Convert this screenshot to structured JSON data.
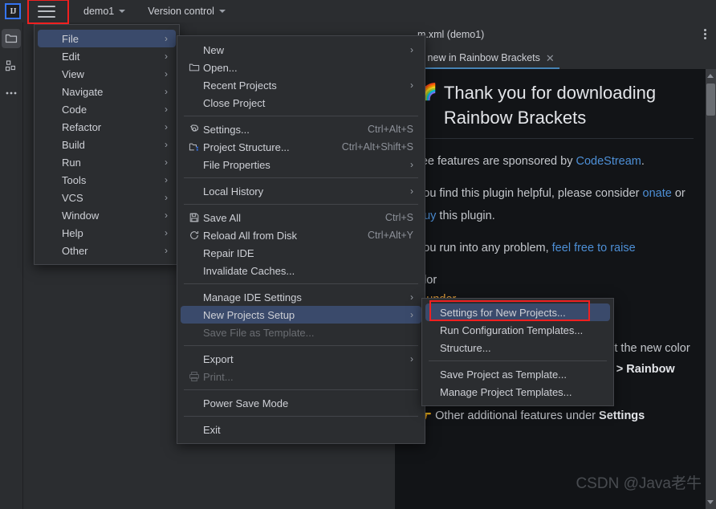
{
  "colors": {
    "bg": "#2b2d30",
    "editor_bg": "#1e1f22",
    "content_bg": "#121417",
    "accent_select": "#3a4a6b",
    "highlight_box": "#f02020",
    "link": "#4d8fd6",
    "tab_underline": "#4682b4",
    "text": "#ced0d6",
    "muted": "#8d9199"
  },
  "titlebar": {
    "logo_text": "IJ",
    "hamburger_icon": "hamburger-menu-icon",
    "project_name": "demo1",
    "version_control": "Version control"
  },
  "rail": {
    "items": [
      {
        "name": "project-tool-window",
        "icon": "folder-icon",
        "active": true
      },
      {
        "name": "structure-tool-window",
        "icon": "structure-icon",
        "active": false
      },
      {
        "name": "more-tool-windows",
        "icon": "ellipsis-icon",
        "active": false
      }
    ]
  },
  "editor": {
    "file_label": "m.xml (demo1)",
    "kebab_icon": "more-vertical-icon",
    "tab": {
      "label": "at's new in Rainbow Brackets",
      "close_icon": "close-icon"
    },
    "scrollbar": {
      "up_icon": "scroll-up-arrow-icon",
      "down_icon": "scroll-down-arrow-icon"
    }
  },
  "whats_new": {
    "rainbow_icon": "rainbow-emoji",
    "heading": "Thank you for downloading Rainbow Brackets",
    "p1_pre": "ree features are sponsored by ",
    "p1_link": "CodeStream",
    "p1_post": ".",
    "p2_pre": "you find this plugin helpful, please consider ",
    "p2_link1": "onate",
    "p2_mid": " or ",
    "p2_link2": "buy",
    "p2_post": " this plugin.",
    "p3_pre": "you run into any problem, ",
    "p3_link": "feel free to raise",
    "frag_color": "olor",
    "frag_under": "it under",
    "frag_gt": ">",
    "bullet1_icon": "pointing-finger-icon",
    "bullet1_pre": "Tired of the bundled colors? Try out the new color generator! ",
    "bullet1_bold": "Settings > Other Settings > Rainbow Brackets > Use color generator",
    "bullet2_icon": "pointing-finger-icon",
    "bullet2_pre": "Other additional features under ",
    "bullet2_bold": "Settings"
  },
  "menu_main": {
    "items": [
      {
        "label": "File",
        "selected": true,
        "submenu": true
      },
      {
        "label": "Edit",
        "selected": false,
        "submenu": true
      },
      {
        "label": "View",
        "selected": false,
        "submenu": true
      },
      {
        "label": "Navigate",
        "selected": false,
        "submenu": true
      },
      {
        "label": "Code",
        "selected": false,
        "submenu": true
      },
      {
        "label": "Refactor",
        "selected": false,
        "submenu": true
      },
      {
        "label": "Build",
        "selected": false,
        "submenu": true
      },
      {
        "label": "Run",
        "selected": false,
        "submenu": true
      },
      {
        "label": "Tools",
        "selected": false,
        "submenu": true
      },
      {
        "label": "VCS",
        "selected": false,
        "submenu": true
      },
      {
        "label": "Window",
        "selected": false,
        "submenu": true
      },
      {
        "label": "Help",
        "selected": false,
        "submenu": true
      },
      {
        "label": "Other",
        "selected": false,
        "submenu": true
      }
    ]
  },
  "menu_file": {
    "groups": [
      {
        "items": [
          {
            "label": "New",
            "icon": "",
            "accel": "",
            "submenu": true,
            "disabled": false,
            "selected": false
          },
          {
            "label": "Open...",
            "icon": "folder-icon",
            "accel": "",
            "submenu": false,
            "disabled": false,
            "selected": false
          },
          {
            "label": "Recent Projects",
            "icon": "",
            "accel": "",
            "submenu": true,
            "disabled": false,
            "selected": false
          },
          {
            "label": "Close Project",
            "icon": "",
            "accel": "",
            "submenu": false,
            "disabled": false,
            "selected": false
          }
        ]
      },
      {
        "items": [
          {
            "label": "Settings...",
            "icon": "gear-icon",
            "accel": "Ctrl+Alt+S",
            "submenu": false,
            "disabled": false,
            "selected": false
          },
          {
            "label": "Project Structure...",
            "icon": "project-structure-icon",
            "accel": "Ctrl+Alt+Shift+S",
            "submenu": false,
            "disabled": false,
            "selected": false
          },
          {
            "label": "File Properties",
            "icon": "",
            "accel": "",
            "submenu": true,
            "disabled": false,
            "selected": false
          }
        ]
      },
      {
        "items": [
          {
            "label": "Local History",
            "icon": "",
            "accel": "",
            "submenu": true,
            "disabled": false,
            "selected": false
          }
        ]
      },
      {
        "items": [
          {
            "label": "Save All",
            "icon": "save-icon",
            "accel": "Ctrl+S",
            "submenu": false,
            "disabled": false,
            "selected": false
          },
          {
            "label": "Reload All from Disk",
            "icon": "refresh-icon",
            "accel": "Ctrl+Alt+Y",
            "submenu": false,
            "disabled": false,
            "selected": false
          },
          {
            "label": "Repair IDE",
            "icon": "",
            "accel": "",
            "submenu": false,
            "disabled": false,
            "selected": false
          },
          {
            "label": "Invalidate Caches...",
            "icon": "",
            "accel": "",
            "submenu": false,
            "disabled": false,
            "selected": false
          }
        ]
      },
      {
        "items": [
          {
            "label": "Manage IDE Settings",
            "icon": "",
            "accel": "",
            "submenu": true,
            "disabled": false,
            "selected": false
          },
          {
            "label": "New Projects Setup",
            "icon": "",
            "accel": "",
            "submenu": true,
            "disabled": false,
            "selected": true
          },
          {
            "label": "Save File as Template...",
            "icon": "",
            "accel": "",
            "submenu": false,
            "disabled": true,
            "selected": false
          }
        ]
      },
      {
        "items": [
          {
            "label": "Export",
            "icon": "",
            "accel": "",
            "submenu": true,
            "disabled": false,
            "selected": false
          },
          {
            "label": "Print...",
            "icon": "print-icon",
            "accel": "",
            "submenu": false,
            "disabled": true,
            "selected": false
          }
        ]
      },
      {
        "items": [
          {
            "label": "Power Save Mode",
            "icon": "",
            "accel": "",
            "submenu": false,
            "disabled": false,
            "selected": false
          }
        ]
      },
      {
        "items": [
          {
            "label": "Exit",
            "icon": "",
            "accel": "",
            "submenu": false,
            "disabled": false,
            "selected": false
          }
        ]
      }
    ]
  },
  "menu_new_projects_setup": {
    "groups": [
      {
        "items": [
          {
            "label": "Settings for New Projects...",
            "selected": true,
            "highlighted": true
          },
          {
            "label": "Run Configuration Templates...",
            "selected": false,
            "highlighted": false
          },
          {
            "label": "Structure...",
            "selected": false,
            "highlighted": false
          }
        ]
      },
      {
        "items": [
          {
            "label": "Save Project as Template...",
            "selected": false,
            "highlighted": false
          },
          {
            "label": "Manage Project Templates...",
            "selected": false,
            "highlighted": false
          }
        ]
      }
    ]
  },
  "watermark": "CSDN @Java老牛"
}
